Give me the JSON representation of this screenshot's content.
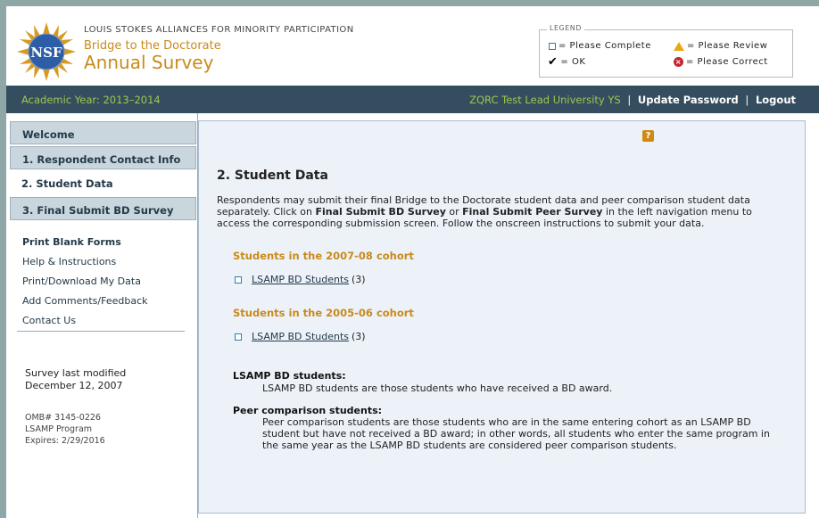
{
  "header": {
    "org_name": "LOUIS STOKES ALLIANCES FOR MINORITY PARTICIPATION",
    "subtitle": "Bridge to the Doctorate",
    "title": "Annual Survey",
    "logo_text": "NSF",
    "logo_icon": "nsf-logo"
  },
  "legend": {
    "label": "LEGEND",
    "items": [
      {
        "icon": "empty-box-icon",
        "text": "= Please Complete"
      },
      {
        "icon": "warning-icon",
        "text": "= Please Review"
      },
      {
        "icon": "check-icon",
        "text": "= OK"
      },
      {
        "icon": "error-icon",
        "text": "= Please Correct"
      }
    ]
  },
  "topbar": {
    "academic_year": "Academic Year: 2013–2014",
    "university": "ZQRC Test Lead University YS",
    "separator": "|",
    "update_password": "Update Password",
    "logout": "Logout"
  },
  "sidebar": {
    "nav": [
      {
        "label": "Welcome"
      },
      {
        "label": "1. Respondent Contact Info"
      },
      {
        "label": "2. Student Data"
      },
      {
        "label": "3. Final Submit BD Survey"
      }
    ],
    "links": [
      {
        "label": "Print Blank Forms"
      },
      {
        "label": "Help & Instructions"
      },
      {
        "label": "Print/Download My Data"
      },
      {
        "label": "Add Comments/Feedback"
      },
      {
        "label": "Contact Us"
      }
    ],
    "modified_label": "Survey last modified",
    "modified_date": "December 12, 2007",
    "omb": "OMB# 3145-0226",
    "program": "LSAMP Program",
    "expires": "Expires: 2/29/2016"
  },
  "main": {
    "help_label": "?",
    "heading": "2. Student Data",
    "intro_1": "Respondents may submit their final Bridge to the Doctorate student data and peer comparison student data separately. Click on ",
    "intro_b1": "Final Submit BD Survey",
    "intro_2": " or ",
    "intro_b2": "Final Submit Peer Survey",
    "intro_3": " in the left navigation menu to access the corresponding submission screen. Follow the onscreen instructions to submit your data.",
    "cohorts": [
      {
        "title": "Students in the 2007-08 cohort",
        "link": "LSAMP BD Students ",
        "count": "(3)"
      },
      {
        "title": "Students in the 2005-06 cohort",
        "link": "LSAMP BD Students ",
        "count": "(3)"
      }
    ],
    "defs": [
      {
        "title": "LSAMP BD students:",
        "body": "LSAMP BD students are those students who have received a BD award."
      },
      {
        "title": "Peer comparison students:",
        "body": "Peer comparison students are those students who are in the same entering cohort as an LSAMP BD student but have not received a BD award; in other words, all students who enter the same program in the same year as the LSAMP BD students are considered peer comparison students."
      }
    ]
  },
  "colors": {
    "accent_gold": "#c98a1a",
    "topbar_bg": "#344e5f",
    "topbar_green": "#9cc84f",
    "nav_tab_bg": "#c9d6dd",
    "main_bg": "#edf2f9"
  }
}
